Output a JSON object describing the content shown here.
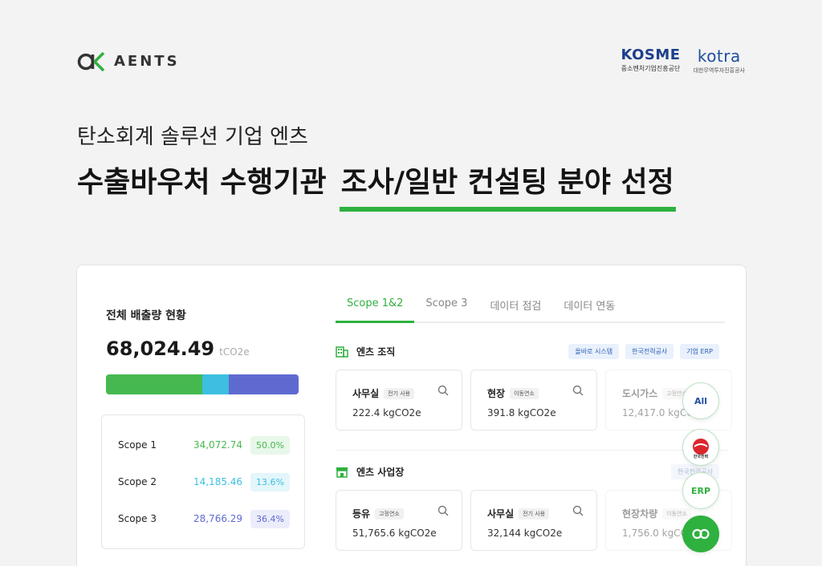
{
  "brand": {
    "name": "AENTS"
  },
  "partners": [
    {
      "name": "KOSME",
      "sub": "중소벤처기업진흥공단"
    },
    {
      "name": "kotra",
      "sub": "대한무역투자진흥공사"
    }
  ],
  "subheadline": "탄소회계 솔루션 기업 엔츠",
  "headline": {
    "part1": "수출바우처 수행기관",
    "part2": "조사/일반 컨설팅 분야 선정"
  },
  "summary": {
    "title": "전체 배출량 현황",
    "total": "68,024.49",
    "unit": "tCO2e",
    "scopes": [
      {
        "name": "Scope 1",
        "value": "34,072.74",
        "percent": "50.0%",
        "share": 50.0
      },
      {
        "name": "Scope 2",
        "value": "14,185.46",
        "percent": "13.6%",
        "share": 13.6
      },
      {
        "name": "Scope 3",
        "value": "28,766.29",
        "percent": "36.4%",
        "share": 36.4
      }
    ]
  },
  "colors": {
    "scope1": "#45b94f",
    "scope1_bg": "#e8f7e9",
    "scope2": "#3cbfe0",
    "scope2_bg": "#e3f6fb",
    "scope3": "#5f6ad1",
    "scope3_bg": "#ecedfb",
    "accent": "#2fb13f"
  },
  "tabs": [
    "Scope 1&2",
    "Scope 3",
    "데이터 점검",
    "데이터 연동"
  ],
  "org": {
    "title": "엔츠 조직",
    "chips": [
      "올바로 시스템",
      "한국전력공사",
      "기업 ERP"
    ],
    "items": [
      {
        "name": "사무실",
        "tag": "전기 사용",
        "value": "222.4 kgCO2e"
      },
      {
        "name": "현장",
        "tag": "이동연소",
        "value": "391.8 kgCO2e"
      },
      {
        "name": "도시가스",
        "tag": "고정연소",
        "value": "12,417.0 kgCO2e"
      }
    ]
  },
  "site": {
    "title": "엔츠 사업장",
    "chips": [
      "한국전력공사"
    ],
    "items": [
      {
        "name": "등유",
        "tag": "고정연소",
        "value": "51,765.6 kgCO2e"
      },
      {
        "name": "사무실",
        "tag": "전기 사용",
        "value": "32,144 kgCO2e"
      },
      {
        "name": "현장차량",
        "tag": "이동연소",
        "value": "1,756.0 kgCO2e"
      }
    ]
  },
  "integrations": [
    {
      "label": "All",
      "icon": "allbaro-icon"
    },
    {
      "label": "한국전력",
      "icon": "kepco-icon"
    },
    {
      "label": "ERP",
      "icon": "erp-icon"
    },
    {
      "label": "",
      "icon": "link-icon"
    }
  ]
}
